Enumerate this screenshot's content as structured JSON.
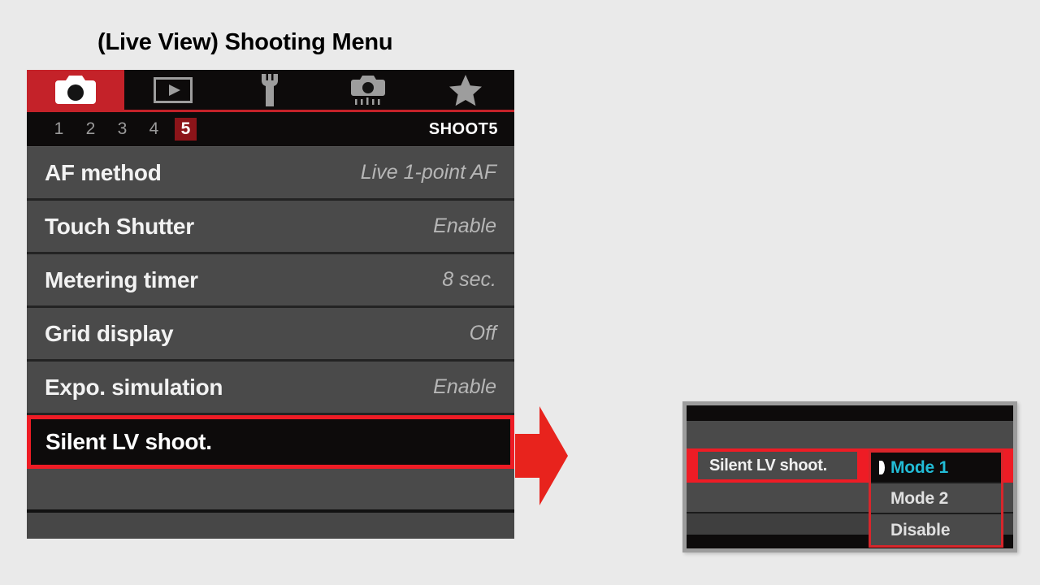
{
  "title": "(Live View) Shooting Menu",
  "colors": {
    "accent_red": "#c42229",
    "highlight_red": "#ee1c25",
    "selected_cyan": "#22bcd6",
    "row_gray": "#4a4a4a",
    "bar_black": "#0d0b0b",
    "page_bg": "#eaeaea"
  },
  "menu": {
    "tabs": [
      {
        "name": "shooting-tab",
        "icon": "camera-icon",
        "active": true
      },
      {
        "name": "playback-tab",
        "icon": "play-box-icon",
        "active": false
      },
      {
        "name": "setup-tab",
        "icon": "wrench-icon",
        "active": false
      },
      {
        "name": "custom-functions-tab",
        "icon": "camera-sliders-icon",
        "active": false
      },
      {
        "name": "my-menu-tab",
        "icon": "star-icon",
        "active": false
      }
    ],
    "pages": [
      "1",
      "2",
      "3",
      "4",
      "5"
    ],
    "selected_page": "5",
    "page_group_label": "SHOOT5",
    "rows": [
      {
        "label": "AF method",
        "value": "Live 1-point AF",
        "highlighted": false
      },
      {
        "label": "Touch Shutter",
        "value": "Enable",
        "highlighted": false
      },
      {
        "label": "Metering timer",
        "value": "8 sec.",
        "highlighted": false
      },
      {
        "label": "Grid display",
        "value": "Off",
        "highlighted": false
      },
      {
        "label": "Expo. simulation",
        "value": "Enable",
        "highlighted": false
      },
      {
        "label": "Silent LV shoot.",
        "value": "",
        "highlighted": true
      }
    ]
  },
  "arrow": {
    "name": "right-arrow",
    "color": "#ee1c25"
  },
  "popup": {
    "setting_label": "Silent LV shoot.",
    "options": [
      {
        "label": "Mode 1",
        "selected": true
      },
      {
        "label": "Mode 2",
        "selected": false
      },
      {
        "label": "Disable",
        "selected": false
      }
    ]
  }
}
